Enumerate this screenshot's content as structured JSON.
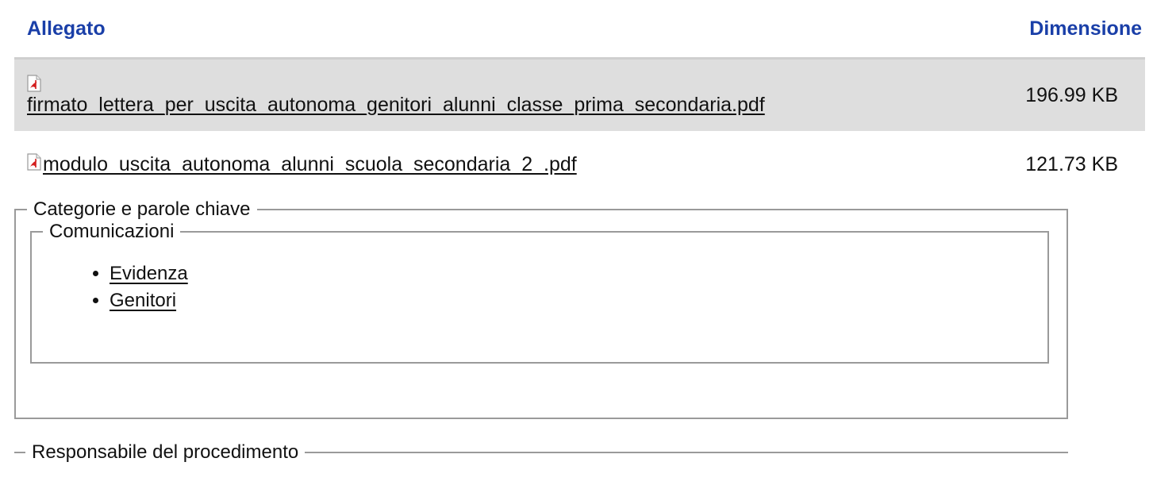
{
  "attachments": {
    "headers": {
      "attachment": "Allegato",
      "size": "Dimensione"
    },
    "files": [
      {
        "name": "firmato_lettera_per_uscita_autonoma_genitori_alunni_classe_prima_secondaria.pdf",
        "size": "196.99 KB",
        "icon": "pdf-icon"
      },
      {
        "name": "modulo_uscita_autonoma_alunni_scuola_secondaria_2_.pdf",
        "size": "121.73 KB",
        "icon": "pdf-icon"
      }
    ]
  },
  "categories": {
    "legend": "Categorie e parole chiave",
    "groups": [
      {
        "legend": "Comunicazioni",
        "items": [
          "Evidenza",
          "Genitori"
        ]
      }
    ]
  },
  "responsible": {
    "legend": "Responsabile del procedimento"
  },
  "colors": {
    "header_text": "#1a3fa8",
    "shaded_row": "#dedede",
    "border": "#9a9a9a",
    "pdf_icon": "#d41f1f"
  }
}
